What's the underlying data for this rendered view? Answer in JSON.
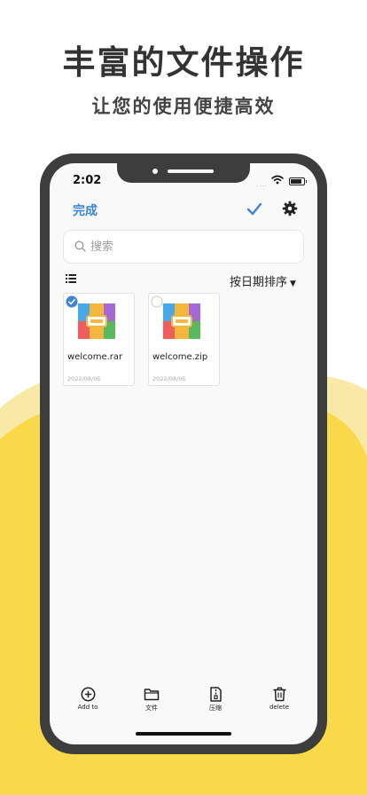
{
  "promo": {
    "headline": "丰富的文件操作",
    "subline": "让您的使用便捷高效"
  },
  "colors": {
    "accent": "#3b82d8",
    "wave_light": "#f8e9a6",
    "wave_yellow": "#f9d94a",
    "phone_frame": "#3d3d3d"
  },
  "status_bar": {
    "time": "2:02",
    "signal_dots": "....",
    "icons": [
      "wifi-icon",
      "battery-icon"
    ]
  },
  "toolbar": {
    "done_label": "完成",
    "icons": [
      "checkmark-icon",
      "gear-icon"
    ]
  },
  "search": {
    "placeholder": "搜索",
    "value": ""
  },
  "list_header": {
    "view_icon": "list-icon",
    "sort_label": "按日期排序",
    "sort_caret": "▼"
  },
  "files": [
    {
      "name": "welcome.rar",
      "date": "2022/08/05",
      "selected": true,
      "icon": "archive-icon"
    },
    {
      "name": "welcome.zip",
      "date": "2022/08/05",
      "selected": false,
      "icon": "archive-icon"
    }
  ],
  "tabbar": [
    {
      "label": "Add to",
      "icon": "add-circle-icon"
    },
    {
      "label": "文件",
      "icon": "folder-icon"
    },
    {
      "label": "压缩",
      "icon": "compress-file-icon"
    },
    {
      "label": "delete",
      "icon": "trash-icon"
    }
  ]
}
